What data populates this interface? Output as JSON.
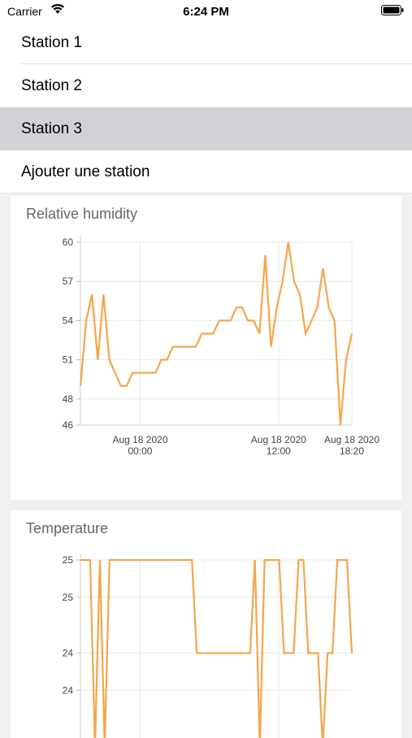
{
  "status": {
    "carrier": "Carrier",
    "time": "6:24 PM"
  },
  "menu": {
    "items": [
      {
        "label": "Station 1"
      },
      {
        "label": "Station 2"
      },
      {
        "label": "Station 3",
        "selected": true
      },
      {
        "label": "Ajouter une station"
      }
    ]
  },
  "colors": {
    "line": "#f5a54a",
    "grid": "#e8e8e8",
    "selected_row": "#d2d2d6"
  },
  "chart_data": [
    {
      "type": "line",
      "title": "Relative humidity",
      "ylim": [
        46,
        60
      ],
      "ytick_labels": [
        "60",
        "57",
        "54",
        "51",
        "48",
        "46"
      ],
      "xtick_labels": [
        {
          "line1": "Aug 18 2020",
          "line2": "00:00"
        },
        {
          "line1": "Aug 18 2020",
          "line2": "12:00"
        },
        {
          "line1": "Aug 18 2020",
          "line2": "18:20"
        }
      ],
      "series": [
        {
          "values": [
            49,
            54,
            56,
            51,
            56,
            51,
            50,
            49,
            49,
            50,
            50,
            50,
            50,
            50,
            51,
            51,
            52,
            52,
            52,
            52,
            52,
            53,
            53,
            53,
            54,
            54,
            54,
            55,
            55,
            54,
            54,
            53,
            59,
            52,
            55,
            57,
            60,
            57,
            56,
            53,
            54,
            55,
            58,
            55,
            54,
            46,
            51,
            53
          ]
        }
      ]
    },
    {
      "type": "line",
      "title": "Temperature",
      "ylim": [
        23,
        25
      ],
      "ytick_labels": [
        "25",
        "25",
        "24",
        "24"
      ],
      "series": [
        {
          "values": [
            25,
            25,
            25,
            23,
            25,
            23,
            25,
            25,
            25,
            25,
            25,
            25,
            25,
            25,
            25,
            25,
            25,
            25,
            25,
            25,
            25,
            25,
            25,
            25,
            24,
            24,
            24,
            24,
            24,
            24,
            24,
            24,
            24,
            24,
            24,
            24,
            25,
            23,
            25,
            25,
            25,
            25,
            24,
            24,
            24,
            25,
            25,
            24,
            24,
            24,
            23,
            24,
            24,
            25,
            25,
            25,
            24
          ]
        }
      ]
    }
  ]
}
